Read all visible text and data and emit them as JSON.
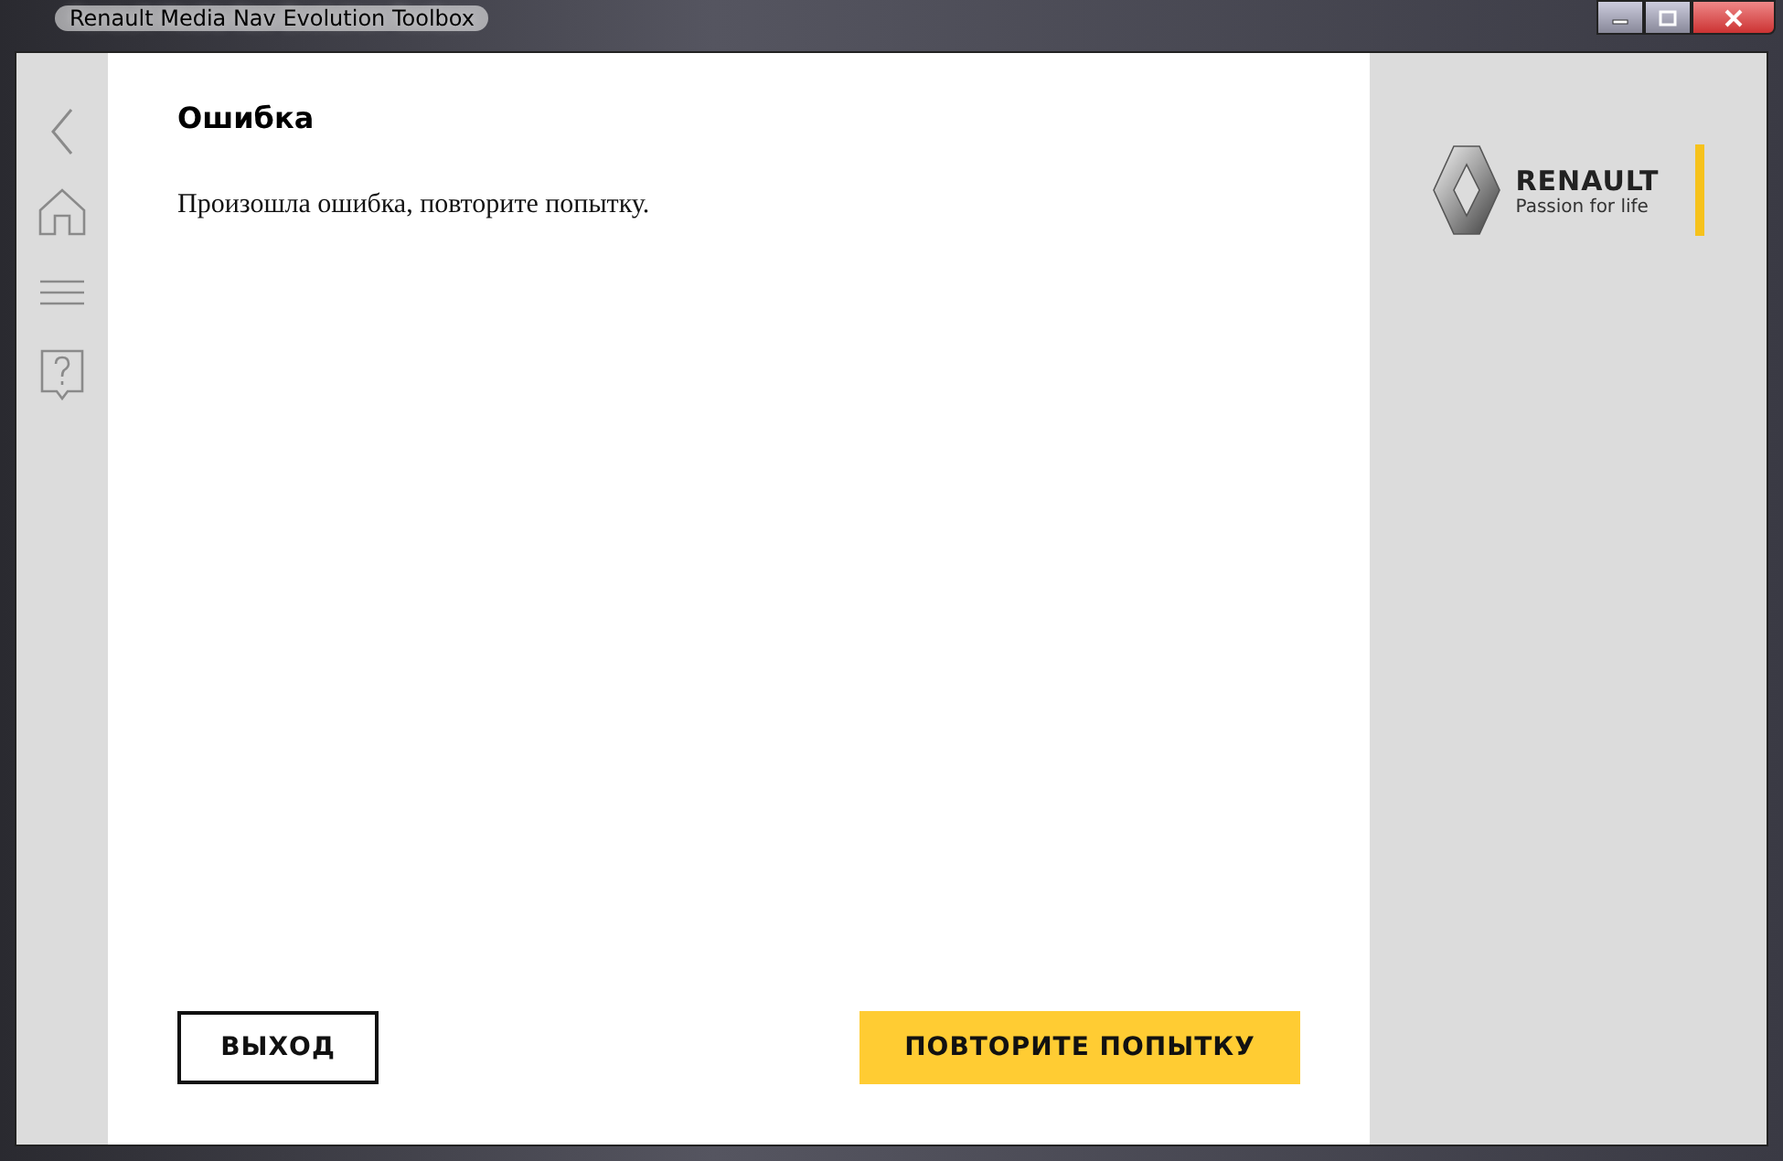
{
  "window": {
    "title": "Renault Media Nav Evolution Toolbox"
  },
  "dialog": {
    "heading": "Ошибка",
    "message": "Произошла ошибка, повторите попытку.",
    "buttons": [
      {
        "label": "ВЫХОД",
        "kind": "secondary"
      },
      {
        "label": "ПОВТОРИТЕ ПОПЫТКУ",
        "kind": "primary"
      }
    ]
  },
  "brand": {
    "name": "RENAULT",
    "tagline": "Passion for life"
  }
}
